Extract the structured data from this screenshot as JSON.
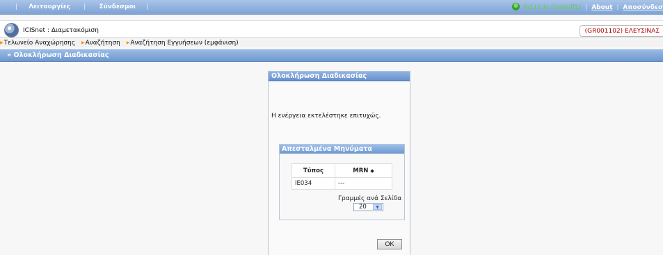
{
  "topbar": {
    "menu_operations": "Λειτουργίες",
    "menu_links": "Σύνδεσμοι",
    "user": "fn111.In (custoff1)",
    "about": "About",
    "logout": "Αποσύνδεσ"
  },
  "header": {
    "app_title": "ICISnet : Διαμετακόμιση",
    "office": "(GR001102) ΕΛΕΥΣΙΝΑΣ"
  },
  "breadcrumb": [
    "Τελωνείο Αναχώρησης",
    "Αναζήτηση",
    "Αναζήτηση Εγγυήσεων (εμφάνιση)"
  ],
  "page_title": "» Ολοκλήρωση Διαδικασίας",
  "dialog": {
    "title": "Ολοκλήρωση Διαδικασίας",
    "message": "Η ενέργεια εκτελέστηκε επιτυχώς.",
    "sent_messages": {
      "title": "Απεσταλμένα Μηνύματα",
      "columns": [
        "Τύπος",
        "MRN"
      ],
      "rows": [
        [
          "IE034",
          "---"
        ]
      ],
      "rows_per_page_label": "Γραμμές ανά Σελίδα",
      "rows_per_page": "20"
    },
    "ok": "OK"
  },
  "icons": {
    "user": "user-status-icon",
    "logo": "icisnet-logo-icon",
    "breadcrumb": "orange-triangle-icon",
    "sort": "sort-icon",
    "select": "dropdown-arrow-icon"
  }
}
